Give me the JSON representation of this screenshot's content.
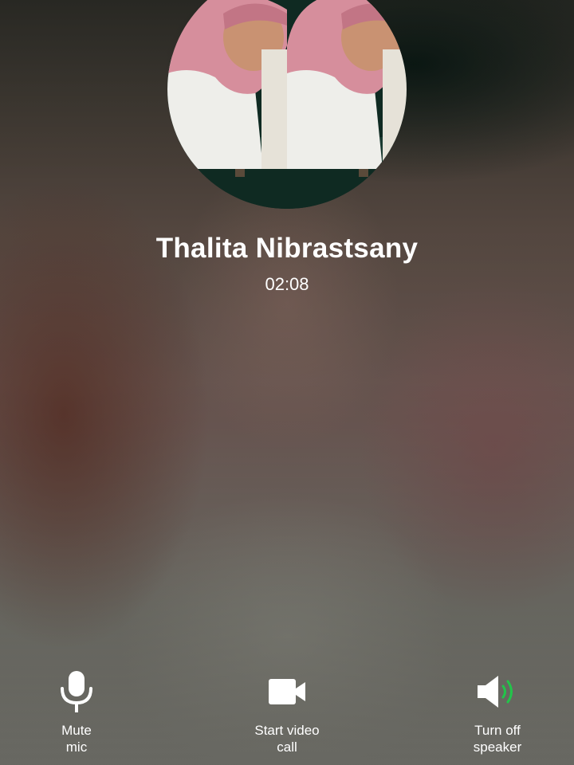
{
  "call": {
    "contact_name": "Thalita Nibrastsany",
    "duration": "02:08"
  },
  "actions": [
    {
      "label": "Mute\nmic",
      "icon": "microphone-icon"
    },
    {
      "label": "Start video\ncall",
      "icon": "video-camera-icon"
    },
    {
      "label": "Turn off\nspeaker",
      "icon": "speaker-on-icon"
    }
  ],
  "colors": {
    "wave_start": "#5ab4e6",
    "wave_end": "#25c46a",
    "speaker_active": "#22c44a"
  }
}
